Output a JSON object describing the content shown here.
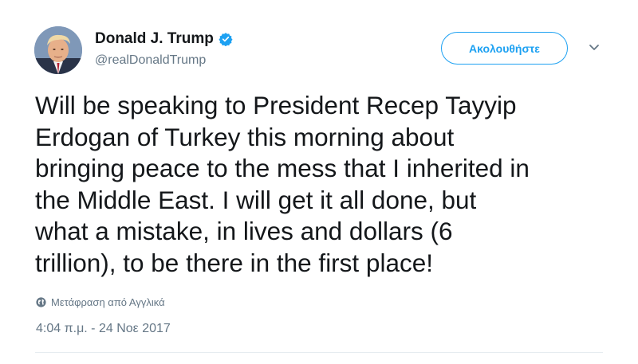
{
  "author": {
    "display_name": "Donald J. Trump",
    "handle": "@realDonaldTrump",
    "verified": true,
    "avatar_icon": "profile-photo"
  },
  "follow_button": {
    "label": "Ακολουθήστε"
  },
  "menu_icon": "chevron-down-icon",
  "tweet": {
    "text": "Will be speaking to President Recep Tayyip\nErdogan of Turkey this morning about\nbringing peace to the mess that I inherited in\nthe Middle East. I will get it all done, but\nwhat a mistake, in lives and dollars (6\ntrillion), to be there in the first place!",
    "translate_label": "Μετάφραση από Αγγλικά",
    "timestamp": "4:04 π.μ. - 24 Νοε 2017"
  },
  "colors": {
    "accent": "#1da1f2",
    "text": "#14171a",
    "secondary_text": "#657786",
    "divider": "#e6ecf0"
  }
}
